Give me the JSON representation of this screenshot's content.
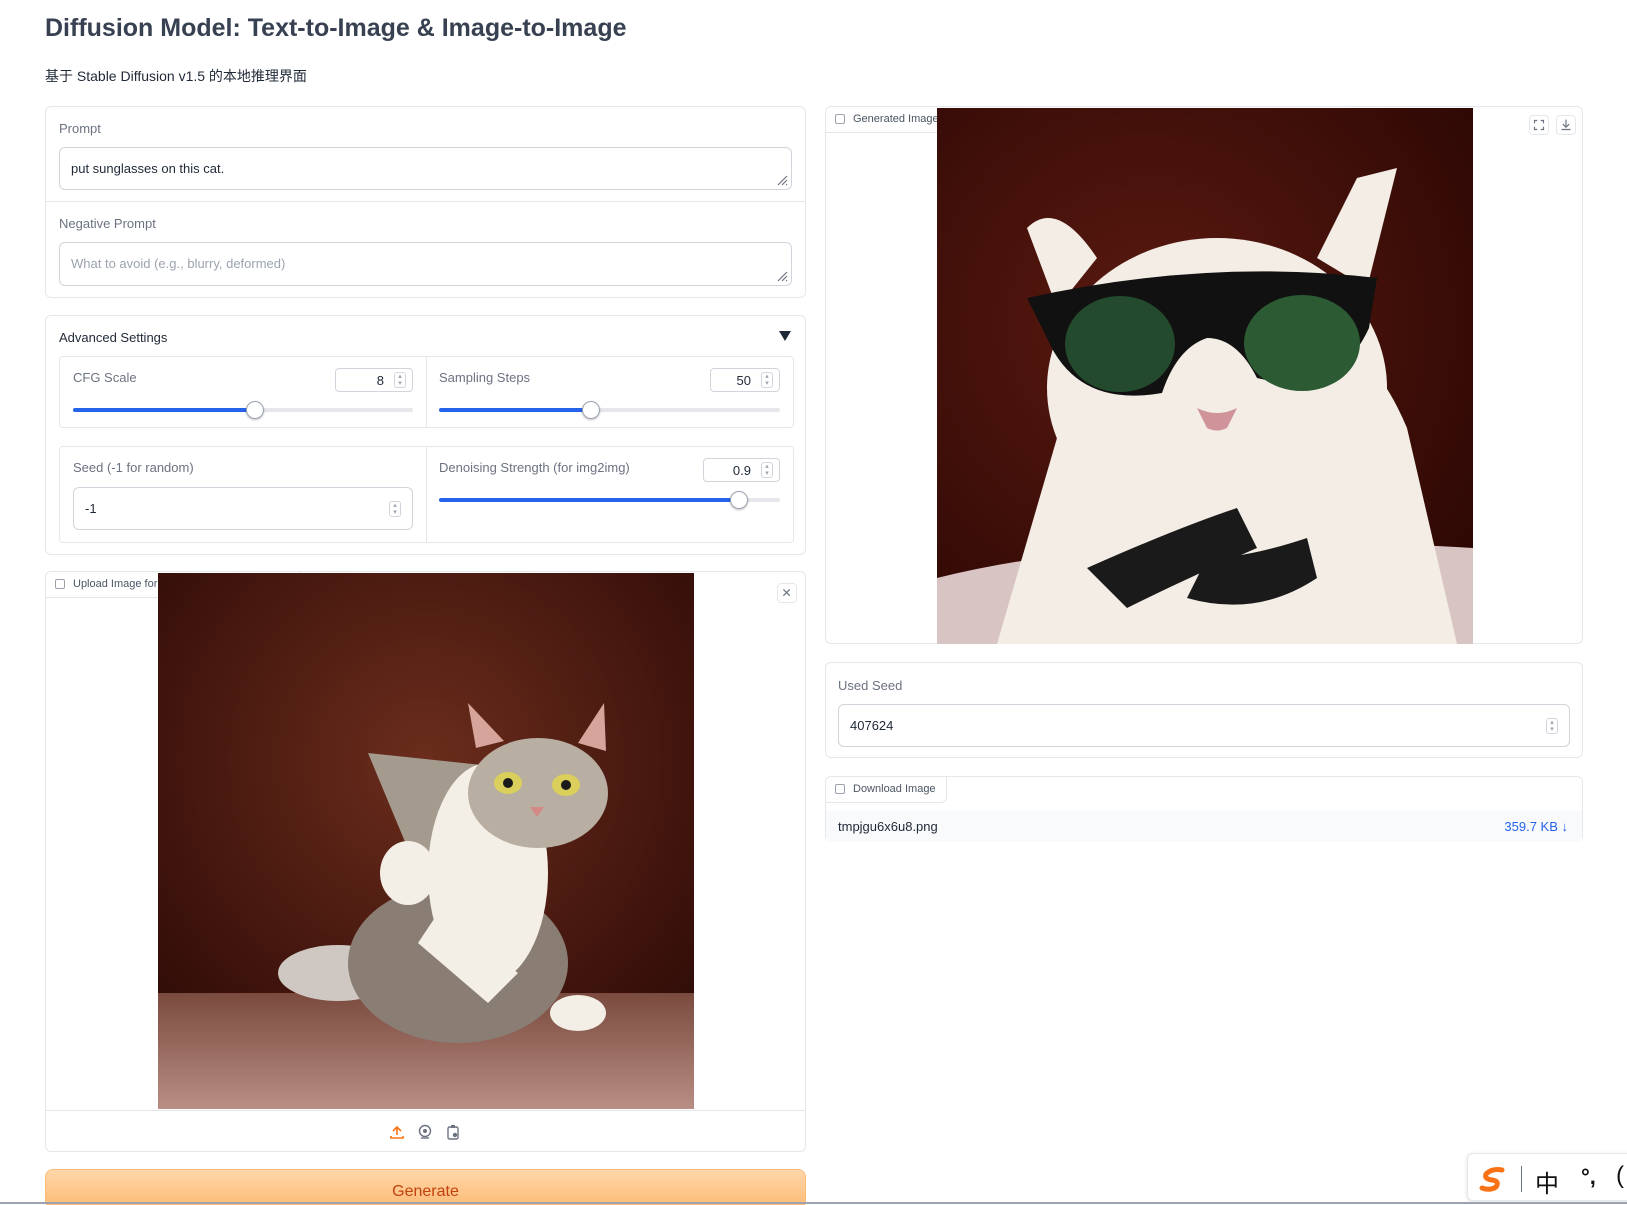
{
  "header": {
    "title": "Diffusion Model: Text-to-Image & Image-to-Image",
    "subtitle": "基于 Stable Diffusion v1.5 的本地推理界面"
  },
  "prompt": {
    "label": "Prompt",
    "value": "put sunglasses on this cat."
  },
  "negative_prompt": {
    "label": "Negative Prompt",
    "placeholder": "What to avoid (e.g., blurry, deformed)"
  },
  "advanced": {
    "label": "Advanced Settings",
    "cfg": {
      "label": "CFG Scale",
      "value": "8",
      "fraction": 0.535
    },
    "steps": {
      "label": "Sampling Steps",
      "value": "50",
      "fraction": 0.445
    },
    "seed": {
      "label": "Seed (-1 for random)",
      "value": "-1"
    },
    "denoise": {
      "label": "Denoising Strength (for img2img)",
      "value": "0.9",
      "fraction": 0.88
    }
  },
  "upload": {
    "label": "Upload Image for Image-to-Image (Optional)"
  },
  "generate_label": "Generate",
  "output": {
    "image_label": "Generated Image",
    "used_seed_label": "Used Seed",
    "used_seed_value": "407624",
    "download_label": "Download Image",
    "file_name": "tmpjgu6x6u8.png",
    "file_size": "359.7 KB ↓"
  },
  "ime": {
    "mode": "中",
    "punct": "°,"
  },
  "colors": {
    "accent": "#2563eb",
    "generate_bg": "#fdba74",
    "generate_text": "#c2410c"
  }
}
